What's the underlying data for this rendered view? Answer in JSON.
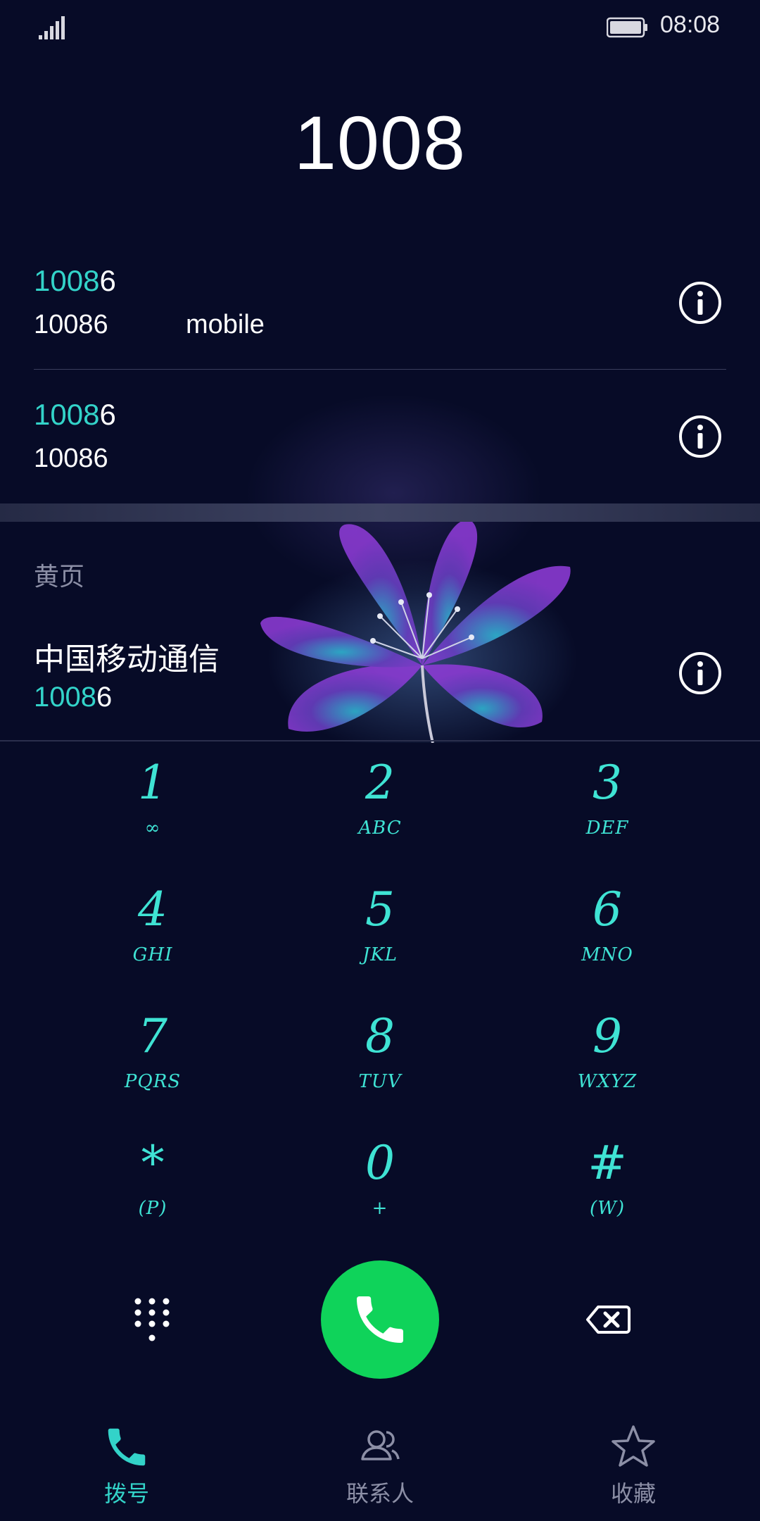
{
  "status_bar": {
    "time": "08:08"
  },
  "dialed_number": "1008",
  "results": [
    {
      "highlight": "1008",
      "rest": "6",
      "sub": "10086",
      "type": "mobile"
    },
    {
      "highlight": "1008",
      "rest": "6",
      "sub": "10086",
      "type": ""
    }
  ],
  "yellow_pages": {
    "section_label": "黄页",
    "name": "中国移动通信",
    "number_highlight": "1008",
    "number_rest": "6"
  },
  "keypad": [
    {
      "digit": "1",
      "letters": "∞"
    },
    {
      "digit": "2",
      "letters": "ABC"
    },
    {
      "digit": "3",
      "letters": "DEF"
    },
    {
      "digit": "4",
      "letters": "GHI"
    },
    {
      "digit": "5",
      "letters": "JKL"
    },
    {
      "digit": "6",
      "letters": "MNO"
    },
    {
      "digit": "7",
      "letters": "PQRS"
    },
    {
      "digit": "8",
      "letters": "TUV"
    },
    {
      "digit": "9",
      "letters": "WXYZ"
    },
    {
      "digit": "*",
      "letters": "(P)"
    },
    {
      "digit": "0",
      "letters": "+"
    },
    {
      "digit": "#",
      "letters": "(W)"
    }
  ],
  "nav": {
    "dial": "拨号",
    "contacts": "联系人",
    "favorites": "收藏"
  },
  "colors": {
    "accent": "#33d3c9",
    "call_green": "#0fd35a",
    "background": "#070b27"
  }
}
